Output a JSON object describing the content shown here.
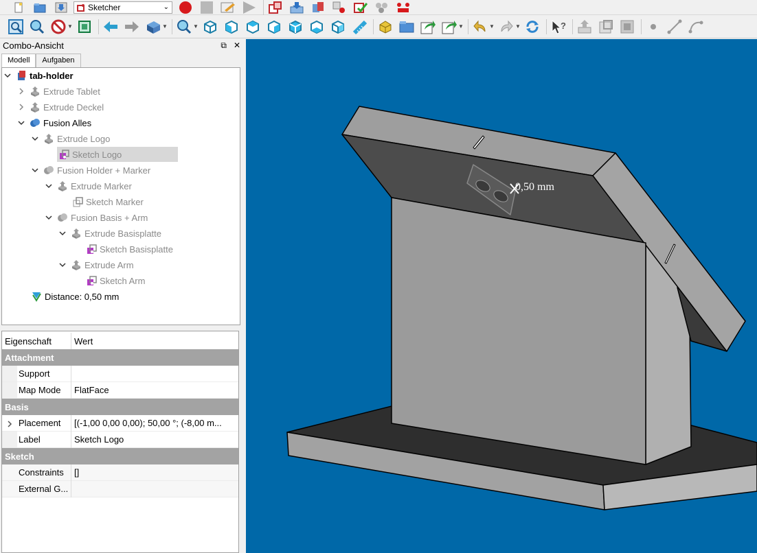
{
  "toolbar": {
    "workbench": "Sketcher",
    "icons_row1": [
      "new-file-icon",
      "open-file-icon",
      "save-icon",
      "workbench-selector",
      "record-macro-icon",
      "stop-macro-icon",
      "edit-macro-icon",
      "run-macro-icon",
      "dependency-graph-icon",
      "export-icon",
      "std-part-icon",
      "links-icon",
      "check-geometry-icon",
      "macro-icon"
    ],
    "icons_row2": [
      "fit-all-icon",
      "fit-selection-icon",
      "draw-style-icon",
      "bounding-box-icon",
      "back-icon",
      "forward-icon",
      "std-views-icon",
      "view-zoom-icon",
      "isometric-icon",
      "front-view-icon",
      "top-view-icon",
      "right-view-icon",
      "rear-view-icon",
      "bottom-view-icon",
      "left-view-icon",
      "measure-icon",
      "part-icon",
      "group-icon",
      "link-icon",
      "sub-link-icon",
      "undo-icon",
      "redo-icon",
      "refresh-icon",
      "whats-this-icon",
      "upload-icon",
      "sketch-view-icon",
      "section-view-icon",
      "point-icon",
      "line-icon",
      "arc-icon"
    ]
  },
  "combo": {
    "title": "Combo-Ansicht",
    "tabs": [
      "Modell",
      "Aufgaben"
    ],
    "tree": [
      {
        "label": "tab-holder",
        "expanded": true
      },
      {
        "label": "Extrude Tablet"
      },
      {
        "label": "Extrude Deckel"
      },
      {
        "label": "Fusion Alles",
        "expanded": true
      },
      {
        "label": "Extrude Logo",
        "expanded": true
      },
      {
        "label": "Sketch Logo",
        "selected": true
      },
      {
        "label": "Fusion Holder + Marker",
        "expanded": true
      },
      {
        "label": "Extrude Marker",
        "expanded": true
      },
      {
        "label": "Sketch Marker"
      },
      {
        "label": "Fusion Basis + Arm",
        "expanded": true
      },
      {
        "label": "Extrude Basisplatte",
        "expanded": true
      },
      {
        "label": "Sketch Basisplatte"
      },
      {
        "label": "Extrude Arm",
        "expanded": true
      },
      {
        "label": "Sketch Arm"
      },
      {
        "label": "Distance: 0,50 mm"
      }
    ]
  },
  "properties": {
    "col_property": "Eigenschaft",
    "col_value": "Wert",
    "groups": [
      {
        "name": "Attachment",
        "items": [
          {
            "prop": "Support",
            "value": ""
          },
          {
            "prop": "Map Mode",
            "value": "FlatFace"
          }
        ]
      },
      {
        "name": "Basis",
        "items": [
          {
            "prop": "Placement",
            "value": "[(-1,00 0,00 0,00); 50,00 °; (-8,00 m..."
          },
          {
            "prop": "Label",
            "value": "Sketch Logo"
          }
        ]
      },
      {
        "name": "Sketch",
        "items": [
          {
            "prop": "Constraints",
            "value": "[]"
          },
          {
            "prop": "External G...",
            "value": ""
          }
        ]
      }
    ]
  },
  "view3d": {
    "dimension_label": "0,50 mm",
    "background_color": "#0068a8"
  }
}
